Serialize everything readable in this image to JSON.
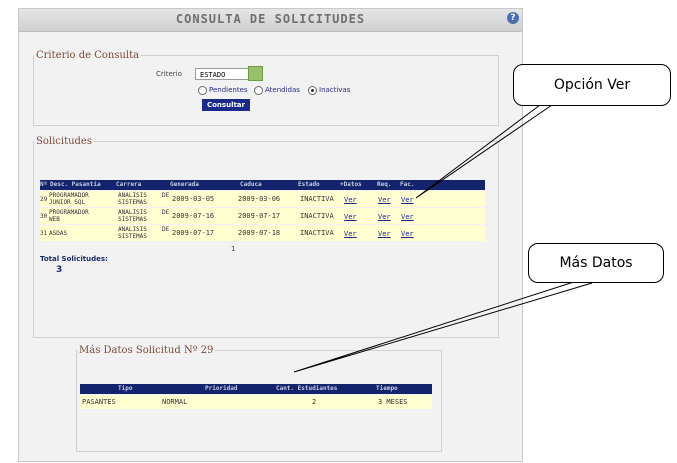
{
  "header": {
    "title": "CONSULTA DE SOLICITUDES",
    "help_symbol": "?"
  },
  "criteria": {
    "legend": "Criterio de Consulta",
    "field_label": "Criterio",
    "select_value": "ESTADO",
    "radios": [
      {
        "label": "Pendientes",
        "checked": false
      },
      {
        "label": "Atendidas",
        "checked": false
      },
      {
        "label": "Inactivas",
        "checked": true
      }
    ],
    "button_label": "Consultar"
  },
  "solicitudes": {
    "legend": "Solicitudes",
    "columns": [
      "Nº",
      "Desc. Pasantía",
      "Carrera",
      "Generada",
      "Caduca",
      "Estado",
      "+Datos",
      "Req.",
      "Fac."
    ],
    "rows": [
      {
        "num": "29",
        "desc1": "PROGRAMADOR",
        "desc2": "JUNIOR SQL",
        "car1": "ANALISIS",
        "car2": "SISTEMAS",
        "de": "DE",
        "generada": "2009-03-05",
        "caduca": "2009-03-06",
        "estado": "INACTIVA",
        "ver1": "Ver",
        "ver2": "Ver",
        "ver3": "Ver"
      },
      {
        "num": "30",
        "desc1": "PROGRAMADOR",
        "desc2": "WEB",
        "car1": "ANALISIS",
        "car2": "SISTEMAS",
        "de": "DE",
        "generada": "2009-07-16",
        "caduca": "2009-07-17",
        "estado": "INACTIVA",
        "ver1": "Ver",
        "ver2": "Ver",
        "ver3": "Ver"
      },
      {
        "num": "31",
        "desc1": "ASDAS",
        "desc2": "",
        "car1": "ANALISIS",
        "car2": "SISTEMAS",
        "de": "DE",
        "generada": "2009-07-17",
        "caduca": "2009-07-18",
        "estado": "INACTIVA",
        "ver1": "Ver",
        "ver2": "Ver",
        "ver3": "Ver"
      }
    ],
    "page": "1",
    "total_label": "Total Solicitudes:",
    "total_value": "3"
  },
  "mas_datos": {
    "legend": "Más Datos Solicitud Nº 29",
    "columns": [
      "Tipo",
      "Prioridad",
      "Cant. Estudiantes",
      "Tiempo"
    ],
    "row": {
      "tipo": "PASANTES",
      "prioridad": "NORMAL",
      "cantidad": "2",
      "tiempo": "3 MESES"
    }
  },
  "callouts": {
    "ver": "Opción Ver",
    "mas": "Más Datos"
  },
  "colors": {
    "header_row": "#14246c",
    "data_row": "#ffffd2",
    "link": "#1a2a8c",
    "button": "#1b2a8a"
  }
}
